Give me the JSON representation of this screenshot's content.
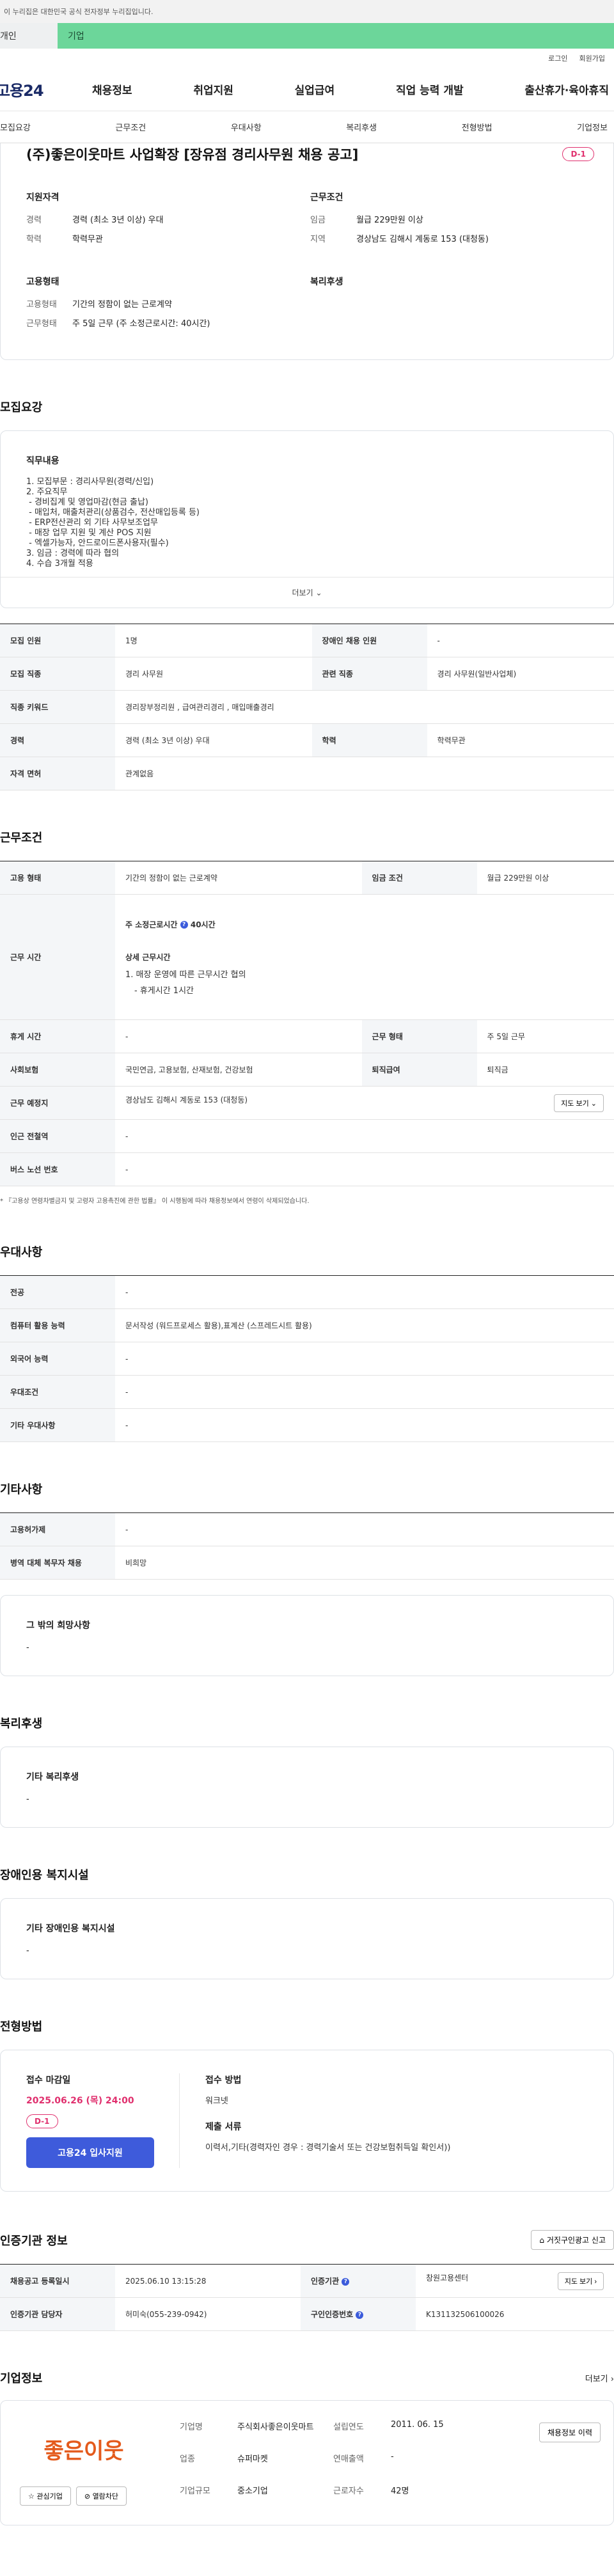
{
  "gov_banner": {
    "text": "이 누리집은 대한민국 공식 전자정부 누리집입니다."
  },
  "user_tabs": {
    "personal": "개인",
    "company": "기업"
  },
  "top_links": {
    "login": "로그인",
    "signup": "회원가입"
  },
  "gnb": {
    "logo": "고용24",
    "menu": [
      "채용정보",
      "취업지원",
      "실업급여",
      "직업 능력 개발",
      "출산휴가·육아휴직"
    ]
  },
  "subnav": [
    "모집요강",
    "근무조건",
    "우대사항",
    "복리후생",
    "전형방법",
    "기업정보"
  ],
  "summary": {
    "title": "(주)좋은이웃마트 사업확장 [장유점 경리사무원 채용 공고]",
    "dday": "D-1",
    "qual_title": "지원자격",
    "qual": [
      {
        "k": "경력",
        "v": "경력 (최소 3년 이상) 우대"
      },
      {
        "k": "학력",
        "v": "학력무관"
      }
    ],
    "cond_title": "근무조건",
    "cond": [
      {
        "k": "임금",
        "v": "월급 229만원 이상"
      },
      {
        "k": "지역",
        "v": "경상남도 김해시 계동로 153 (대청동)"
      }
    ],
    "emp_title": "고용형태",
    "emp": [
      {
        "k": "고용형태",
        "v": "기간의 정함이 없는 근로계약"
      },
      {
        "k": "근무형태",
        "v": "주 5일 근무 (주 소정근로시간: 40시간)"
      }
    ],
    "welfare_title": "복리후생"
  },
  "recruit": {
    "section_title": "모집요강",
    "duty_title": "직무내용",
    "duty_lines": [
      "1. 모집부문 : 경리사무원(경력/신입)",
      "2. 주요직무",
      " - 경비집계 및 영업마감(현금 출납)",
      " - 매입처, 매출처관리(상품검수, 전산매입등록 등)",
      " - ERP전산관리 외 기타 사무보조업무",
      " - 매장 업무 지원 및 계산 POS 지원",
      " - 엑셀가능자, 안드로이드폰사용자(필수)",
      "3. 임금 : 경력에 따라 협의",
      "4. 수습 3개월 적용"
    ],
    "more": "더보기",
    "table": [
      [
        "모집 인원",
        "1명",
        "장애인 채용 인원",
        "-"
      ],
      [
        "모집 직종",
        "경리 사무원",
        "관련 직종",
        "경리 사무원(일반사업체)"
      ],
      [
        "직종 키워드",
        "경리장부정리원 , 급여관리경리 , 매입매출경리",
        "",
        ""
      ],
      [
        "경력",
        "경력 (최소 3년 이상) 우대",
        "학력",
        "학력무관"
      ],
      [
        "자격 면허",
        "관계없음",
        "",
        ""
      ]
    ]
  },
  "work": {
    "section_title": "근무조건",
    "emp_type_k": "고용 형태",
    "emp_type_v": "기간의 정함이 없는 근로계약",
    "wage_k": "임금 조건",
    "wage_v": "월급 229만원 이상",
    "hours_k": "근무 시간",
    "hours_weekly": "주 소정근로시간",
    "hours_weekly_v": "40시간",
    "hours_detail_title": "상세 근무시간",
    "hours_detail_1": "1. 매장 운영에 따른 근무시간 협의",
    "hours_detail_2": "- 휴게시간 1시간",
    "rest_k": "휴게 시간",
    "rest_v": "-",
    "form_k": "근무 형태",
    "form_v": "주 5일 근무",
    "insurance_k": "사회보험",
    "insurance_v": "국민연금, 고용보험, 산재보험, 건강보험",
    "retire_k": "퇴직급여",
    "retire_v": "퇴직금",
    "place_k": "근무 예정지",
    "place_v": "경상남도 김해시 계동로 153 (대청동)",
    "map_btn": "지도 보기",
    "subway_k": "인근 전철역",
    "subway_v": "-",
    "bus_k": "버스 노선 번호",
    "bus_v": "-",
    "note": "* 『고용상 연령차별금지 및 고령자 고용촉진에 관한 법률』 이 시행됨에 따라 채용정보에서 연령이 삭제되었습니다."
  },
  "pref": {
    "section_title": "우대사항",
    "rows": [
      [
        "전공",
        "-"
      ],
      [
        "컴퓨터 활용 능력",
        "문서작성 (워드프로세스 활용),표계산 (스프레드시트 활용)"
      ],
      [
        "외국어 능력",
        "-"
      ],
      [
        "우대조건",
        "-"
      ],
      [
        "기타 우대사항",
        "-"
      ]
    ]
  },
  "etc": {
    "section_title": "기타사항",
    "rows": [
      [
        "고용허가제",
        "-"
      ],
      [
        "병역 대체 복무자 채용",
        "비희망"
      ]
    ],
    "wish_title": "그 밖의 희망사항",
    "wish_v": "-"
  },
  "welfare": {
    "section_title": "복리후생",
    "box_title": "기타 복리후생",
    "box_v": "-"
  },
  "disabled": {
    "section_title": "장애인용 복지시설",
    "box_title": "기타 장애인용 복지시설",
    "box_v": "-"
  },
  "process": {
    "section_title": "전형방법",
    "deadline_title": "접수 마감일",
    "deadline": "2025.06.26 (목) 24:00",
    "dday": "D-1",
    "apply_btn": "고용24 입사지원",
    "method_title": "접수 방법",
    "method_v": "워크넷",
    "docs_title": "제출 서류",
    "docs_v": "이력서,기타(경력자인 경우 : 경력기술서 또는 건강보험취득일 확인서))"
  },
  "agency": {
    "section_title": "인증기관 정보",
    "report_btn": "거짓구인광고 신고",
    "reg_k": "채용공고 등록일시",
    "reg_v": "2025.06.10 13:15:28",
    "agency_k": "인증기관",
    "agency_v": "창원고용센터",
    "map_btn": "지도 보기",
    "manager_k": "인증기관 담당자",
    "manager_v": "허미숙(055-239-0942)",
    "auth_k": "구인인증번호",
    "auth_v": "K131132506100026"
  },
  "company": {
    "section_title": "기업정보",
    "more": "더보기",
    "logo_text": "좋은이웃",
    "interest_btn": "관심기업",
    "block_btn": "열람차단",
    "name_k": "기업명",
    "name_v": "주식회사좋은이웃마트",
    "founded_k": "설립연도",
    "founded_v": "2011. 06. 15",
    "industry_k": "업종",
    "industry_v": "슈퍼마켓",
    "revenue_k": "연매출액",
    "revenue_v": "-",
    "size_k": "기업규모",
    "size_v": "중소기업",
    "staff_k": "근로자수",
    "staff_v": "42명",
    "history_btn": "채용정보 이력"
  }
}
